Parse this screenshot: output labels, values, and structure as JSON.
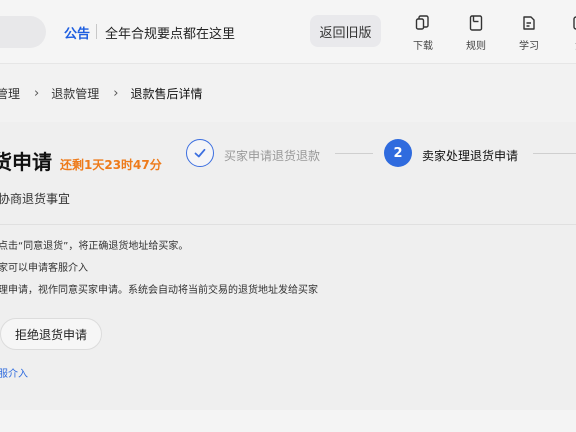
{
  "header": {
    "notice_tag": "公告",
    "notice_text": "全年合规要点都在这里",
    "old_version_button": "返回旧版",
    "tools": [
      {
        "label": "下载",
        "icon": "download-icon"
      },
      {
        "label": "规则",
        "icon": "rules-icon"
      },
      {
        "label": "学习",
        "icon": "learn-icon"
      },
      {
        "label": "活",
        "icon": "more-icon"
      }
    ]
  },
  "breadcrumb": {
    "items": [
      "管理",
      "退款管理",
      "退款售后详情"
    ]
  },
  "main": {
    "title": "货申请",
    "countdown": "还剩1天23时47分",
    "steps": [
      {
        "label": "买家申请退货退款",
        "number": "",
        "state": "done"
      },
      {
        "label": "卖家处理退货申请",
        "number": "2",
        "state": "current"
      }
    ],
    "subtitle": "协商退货事宜",
    "notes": [
      "点击“同意退货”，将正确退货地址给买家。",
      "家可以申请客服介入",
      "理申请，视作同意买家申请。系统会自动将当前交易的退货地址发给买家"
    ],
    "reject_button": "拒绝退货申请",
    "service_link": "服介入"
  },
  "colors": {
    "accent": "#2f6bde",
    "countdown": "#ee7b1b",
    "background": "#f2f2f2"
  }
}
